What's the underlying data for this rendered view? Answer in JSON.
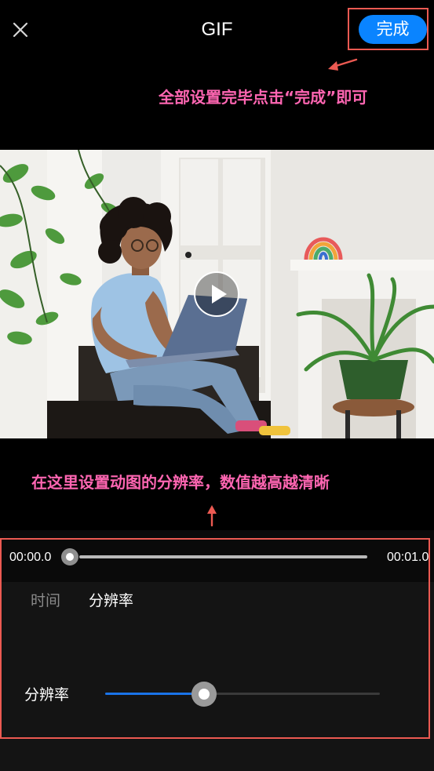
{
  "header": {
    "title": "GIF",
    "done_label": "完成"
  },
  "annotations": {
    "done_hint": "全部设置完毕点击“完成”即可",
    "resolution_hint": "在这里设置动图的分辨率，数值越高越清晰"
  },
  "timeline": {
    "start_time": "00:00.0",
    "end_time": "00:01.0",
    "position": 0
  },
  "tabs": [
    {
      "label": "时间",
      "active": false
    },
    {
      "label": "分辨率",
      "active": true
    }
  ],
  "resolution": {
    "label": "分辨率",
    "value": 0.36
  },
  "colors": {
    "accent": "#0a84ff",
    "slider_fill": "#1a73e8",
    "annotation_text": "#ff66b2",
    "annotation_mark": "#ec5a52"
  },
  "icons": {
    "close": "close-icon",
    "play": "play-icon"
  }
}
